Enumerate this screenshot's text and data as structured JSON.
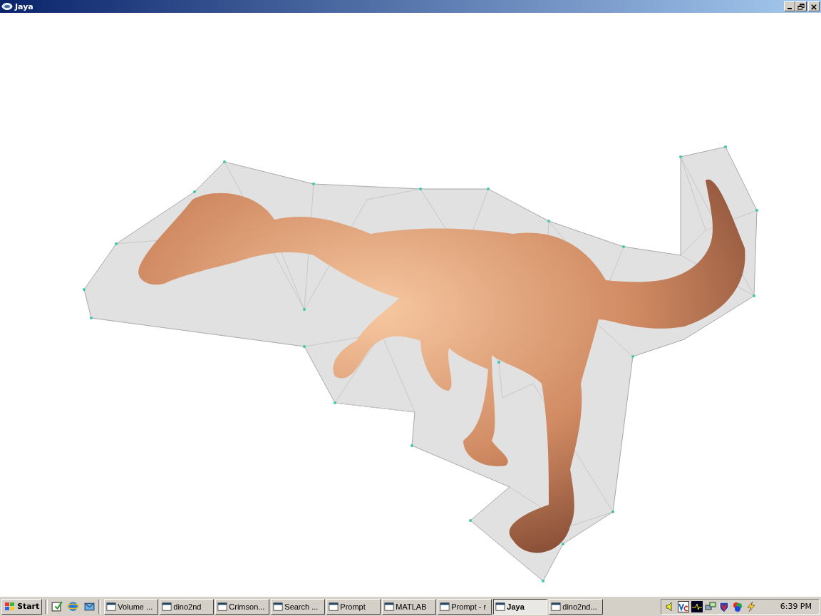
{
  "window": {
    "title": "Jaya"
  },
  "taskbar": {
    "start": "Start",
    "tasks": [
      {
        "label": "Volume ...",
        "selected": false
      },
      {
        "label": "dino2nd",
        "selected": false
      },
      {
        "label": "Crimson...",
        "selected": false
      },
      {
        "label": "Search ...",
        "selected": false
      },
      {
        "label": "Prompt",
        "selected": false
      },
      {
        "label": "MATLAB",
        "selected": false
      },
      {
        "label": "Prompt - r",
        "selected": false
      },
      {
        "label": "Jaya",
        "selected": true
      },
      {
        "label": "dino2nd...",
        "selected": false
      }
    ],
    "clock": "6:39 PM"
  }
}
